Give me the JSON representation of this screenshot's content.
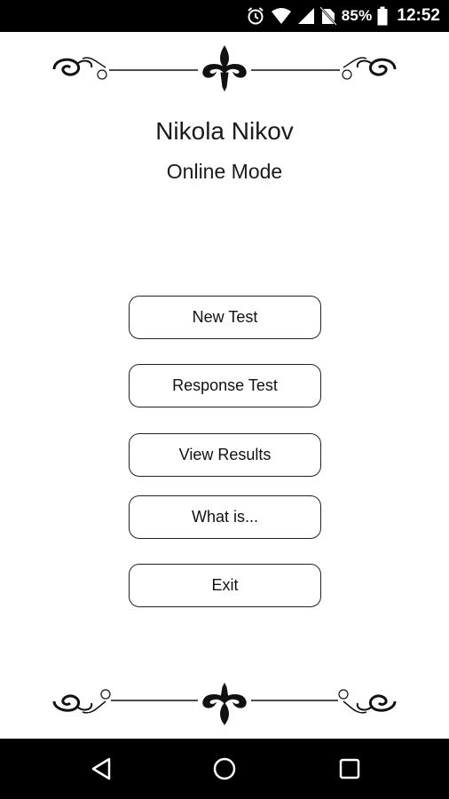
{
  "status_bar": {
    "battery_percent": "85%",
    "time": "12:52",
    "icons": [
      "alarm-icon",
      "wifi-icon",
      "cell-signal-icon",
      "no-sim-icon",
      "battery-icon"
    ]
  },
  "header": {
    "user_name": "Nikola Nikov",
    "mode": "Online Mode"
  },
  "menu": {
    "items": [
      {
        "id": "new-test",
        "label": "New Test"
      },
      {
        "id": "response-test",
        "label": "Response Test"
      },
      {
        "id": "view-results",
        "label": "View Results"
      },
      {
        "id": "what-is",
        "label": "What is..."
      },
      {
        "id": "exit",
        "label": "Exit"
      }
    ]
  },
  "nav_bar": {
    "buttons": [
      "back-icon",
      "home-icon",
      "recents-icon"
    ]
  },
  "colors": {
    "background": "#ffffff",
    "bars": "#000000",
    "text": "#111111",
    "button_border": "#222222"
  }
}
